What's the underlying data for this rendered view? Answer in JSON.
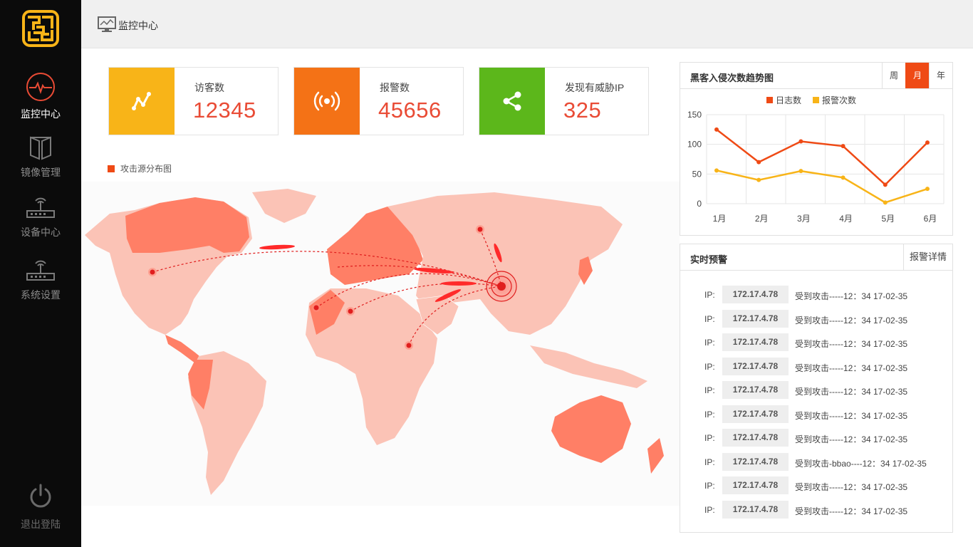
{
  "app": {
    "title": "监控中心"
  },
  "sidebar": {
    "items": [
      {
        "label": "监控中心",
        "icon": "monitor-pulse-icon",
        "active": true
      },
      {
        "label": "镜像管理",
        "icon": "mirror-icon",
        "active": false
      },
      {
        "label": "设备中心",
        "icon": "router-icon",
        "active": false
      },
      {
        "label": "系统设置",
        "icon": "router-settings-icon",
        "active": false
      }
    ],
    "logout_label": "退出登陆"
  },
  "stats": [
    {
      "label": "访客数",
      "value": "12345",
      "color": "#f8b418",
      "icon": "trend-icon"
    },
    {
      "label": "报警数",
      "value": "45656",
      "color": "#f47216",
      "icon": "alarm-icon"
    },
    {
      "label": "发现有威胁IP",
      "value": "325",
      "color": "#5cb71b",
      "icon": "share-icon"
    }
  ],
  "map": {
    "legend": "攻击源分布图",
    "accent": "#ef4a15"
  },
  "trend": {
    "title": "黑客入侵次数趋势图",
    "tabs": [
      {
        "label": "周",
        "active": false
      },
      {
        "label": "月",
        "active": true
      },
      {
        "label": "年",
        "active": false
      }
    ]
  },
  "chart_data": {
    "type": "line",
    "categories": [
      "1月",
      "2月",
      "3月",
      "4月",
      "5月",
      "6月"
    ],
    "series": [
      {
        "name": "日志数",
        "color": "#ef4a15",
        "values": [
          125,
          70,
          105,
          97,
          32,
          103
        ]
      },
      {
        "name": "报警次数",
        "color": "#f8b418",
        "values": [
          56,
          40,
          55,
          44,
          2,
          25
        ]
      }
    ],
    "yticks": [
      0,
      50,
      100,
      150
    ],
    "ylim": [
      0,
      150
    ],
    "grid": true,
    "legend_position": "top"
  },
  "alerts_panel": {
    "title": "实时预警",
    "detail_label": "报警详情",
    "ip_prefix": "IP:",
    "rows": [
      {
        "ip": "172.17.4.78",
        "msg": "受到攻击-----12：34  17-02-35"
      },
      {
        "ip": "172.17.4.78",
        "msg": "受到攻击-----12：34  17-02-35"
      },
      {
        "ip": "172.17.4.78",
        "msg": "受到攻击-----12：34  17-02-35"
      },
      {
        "ip": "172.17.4.78",
        "msg": "受到攻击-----12：34  17-02-35"
      },
      {
        "ip": "172.17.4.78",
        "msg": "受到攻击-----12：34  17-02-35"
      },
      {
        "ip": "172.17.4.78",
        "msg": "受到攻击-----12：34  17-02-35"
      },
      {
        "ip": "172.17.4.78",
        "msg": "受到攻击-----12：34  17-02-35"
      },
      {
        "ip": "172.17.4.78",
        "msg": "受到攻击-bbao----12：34  17-02-35"
      },
      {
        "ip": "172.17.4.78",
        "msg": "受到攻击-----12：34  17-02-35"
      },
      {
        "ip": "172.17.4.78",
        "msg": "受到攻击-----12：34  17-02-35"
      }
    ]
  }
}
